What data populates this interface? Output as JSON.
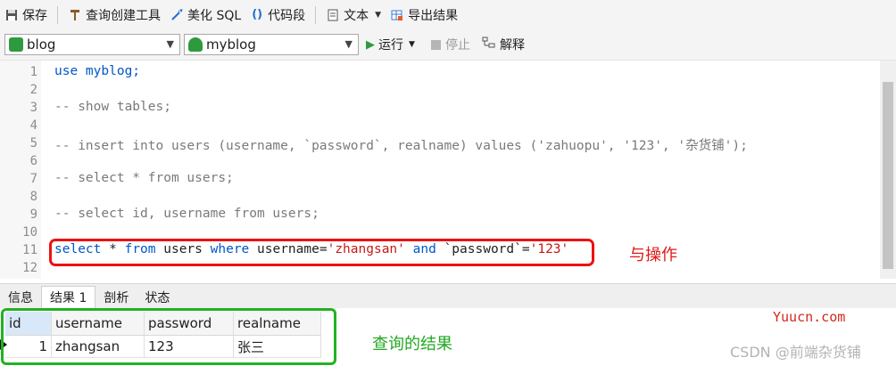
{
  "toolbar": {
    "save": "保存",
    "query_builder": "查询创建工具",
    "beautify_sql": "美化 SQL",
    "code_snippet": "代码段",
    "text": "文本",
    "export_results": "导出结果"
  },
  "toolbar2": {
    "connection": "blog",
    "database": "myblog",
    "run": "运行",
    "stop": "停止",
    "explain": "解释"
  },
  "editor": {
    "line_numbers": [
      "1",
      "2",
      "3",
      "4",
      "5",
      "6",
      "7",
      "8",
      "9",
      "10",
      "11",
      "12"
    ],
    "line1": "use myblog;",
    "line3": "-- show tables;",
    "line5": "-- insert into users (username, `password`, realname) values ('zahuopu', '123', '杂货铺');",
    "line7": "-- select * from users;",
    "line9": "-- select id, username from users;",
    "line11": {
      "k_select": "select",
      "t_star": " * ",
      "k_from": "from",
      "t_users": " users ",
      "k_where": "where",
      "t_username": " username=",
      "s_zhangsan": "'zhangsan'",
      "t_sp1": " ",
      "k_and": "and",
      "t_password": " `password`=",
      "s_123": "'123'"
    }
  },
  "annotations": {
    "and_op": "与操作",
    "query_result": "查询的结果"
  },
  "result_tabs": [
    "信息",
    "结果 1",
    "剖析",
    "状态"
  ],
  "grid": {
    "columns": [
      "id",
      "username",
      "password",
      "realname"
    ],
    "rows": [
      [
        "1",
        "zhangsan",
        "123",
        "张三"
      ]
    ]
  },
  "watermarks": {
    "site": "Yuucn.com",
    "csdn": "CSDN @前端杂货铺"
  },
  "colors": {
    "keyword": "#0058c7",
    "comment": "#7a7a7a",
    "string": "#c41a16",
    "red_box": "#ee1111",
    "green_box": "#22b222"
  }
}
